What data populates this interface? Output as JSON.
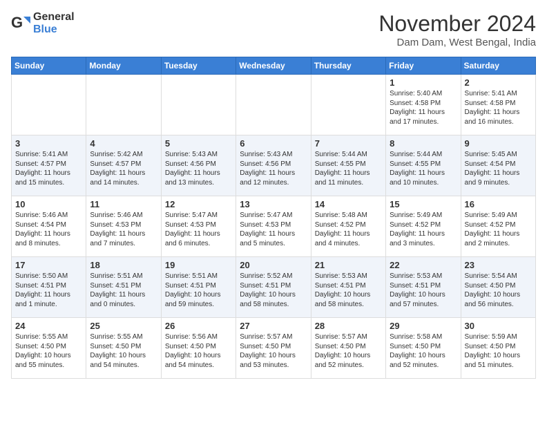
{
  "header": {
    "logo_general": "General",
    "logo_blue": "Blue",
    "month": "November 2024",
    "location": "Dam Dam, West Bengal, India"
  },
  "table": {
    "headers": [
      "Sunday",
      "Monday",
      "Tuesday",
      "Wednesday",
      "Thursday",
      "Friday",
      "Saturday"
    ],
    "rows": [
      [
        {
          "day": "",
          "info": ""
        },
        {
          "day": "",
          "info": ""
        },
        {
          "day": "",
          "info": ""
        },
        {
          "day": "",
          "info": ""
        },
        {
          "day": "",
          "info": ""
        },
        {
          "day": "1",
          "info": "Sunrise: 5:40 AM\nSunset: 4:58 PM\nDaylight: 11 hours and 17 minutes."
        },
        {
          "day": "2",
          "info": "Sunrise: 5:41 AM\nSunset: 4:58 PM\nDaylight: 11 hours and 16 minutes."
        }
      ],
      [
        {
          "day": "3",
          "info": "Sunrise: 5:41 AM\nSunset: 4:57 PM\nDaylight: 11 hours and 15 minutes."
        },
        {
          "day": "4",
          "info": "Sunrise: 5:42 AM\nSunset: 4:57 PM\nDaylight: 11 hours and 14 minutes."
        },
        {
          "day": "5",
          "info": "Sunrise: 5:43 AM\nSunset: 4:56 PM\nDaylight: 11 hours and 13 minutes."
        },
        {
          "day": "6",
          "info": "Sunrise: 5:43 AM\nSunset: 4:56 PM\nDaylight: 11 hours and 12 minutes."
        },
        {
          "day": "7",
          "info": "Sunrise: 5:44 AM\nSunset: 4:55 PM\nDaylight: 11 hours and 11 minutes."
        },
        {
          "day": "8",
          "info": "Sunrise: 5:44 AM\nSunset: 4:55 PM\nDaylight: 11 hours and 10 minutes."
        },
        {
          "day": "9",
          "info": "Sunrise: 5:45 AM\nSunset: 4:54 PM\nDaylight: 11 hours and 9 minutes."
        }
      ],
      [
        {
          "day": "10",
          "info": "Sunrise: 5:46 AM\nSunset: 4:54 PM\nDaylight: 11 hours and 8 minutes."
        },
        {
          "day": "11",
          "info": "Sunrise: 5:46 AM\nSunset: 4:53 PM\nDaylight: 11 hours and 7 minutes."
        },
        {
          "day": "12",
          "info": "Sunrise: 5:47 AM\nSunset: 4:53 PM\nDaylight: 11 hours and 6 minutes."
        },
        {
          "day": "13",
          "info": "Sunrise: 5:47 AM\nSunset: 4:53 PM\nDaylight: 11 hours and 5 minutes."
        },
        {
          "day": "14",
          "info": "Sunrise: 5:48 AM\nSunset: 4:52 PM\nDaylight: 11 hours and 4 minutes."
        },
        {
          "day": "15",
          "info": "Sunrise: 5:49 AM\nSunset: 4:52 PM\nDaylight: 11 hours and 3 minutes."
        },
        {
          "day": "16",
          "info": "Sunrise: 5:49 AM\nSunset: 4:52 PM\nDaylight: 11 hours and 2 minutes."
        }
      ],
      [
        {
          "day": "17",
          "info": "Sunrise: 5:50 AM\nSunset: 4:51 PM\nDaylight: 11 hours and 1 minute."
        },
        {
          "day": "18",
          "info": "Sunrise: 5:51 AM\nSunset: 4:51 PM\nDaylight: 11 hours and 0 minutes."
        },
        {
          "day": "19",
          "info": "Sunrise: 5:51 AM\nSunset: 4:51 PM\nDaylight: 10 hours and 59 minutes."
        },
        {
          "day": "20",
          "info": "Sunrise: 5:52 AM\nSunset: 4:51 PM\nDaylight: 10 hours and 58 minutes."
        },
        {
          "day": "21",
          "info": "Sunrise: 5:53 AM\nSunset: 4:51 PM\nDaylight: 10 hours and 58 minutes."
        },
        {
          "day": "22",
          "info": "Sunrise: 5:53 AM\nSunset: 4:51 PM\nDaylight: 10 hours and 57 minutes."
        },
        {
          "day": "23",
          "info": "Sunrise: 5:54 AM\nSunset: 4:50 PM\nDaylight: 10 hours and 56 minutes."
        }
      ],
      [
        {
          "day": "24",
          "info": "Sunrise: 5:55 AM\nSunset: 4:50 PM\nDaylight: 10 hours and 55 minutes."
        },
        {
          "day": "25",
          "info": "Sunrise: 5:55 AM\nSunset: 4:50 PM\nDaylight: 10 hours and 54 minutes."
        },
        {
          "day": "26",
          "info": "Sunrise: 5:56 AM\nSunset: 4:50 PM\nDaylight: 10 hours and 54 minutes."
        },
        {
          "day": "27",
          "info": "Sunrise: 5:57 AM\nSunset: 4:50 PM\nDaylight: 10 hours and 53 minutes."
        },
        {
          "day": "28",
          "info": "Sunrise: 5:57 AM\nSunset: 4:50 PM\nDaylight: 10 hours and 52 minutes."
        },
        {
          "day": "29",
          "info": "Sunrise: 5:58 AM\nSunset: 4:50 PM\nDaylight: 10 hours and 52 minutes."
        },
        {
          "day": "30",
          "info": "Sunrise: 5:59 AM\nSunset: 4:50 PM\nDaylight: 10 hours and 51 minutes."
        }
      ]
    ]
  }
}
